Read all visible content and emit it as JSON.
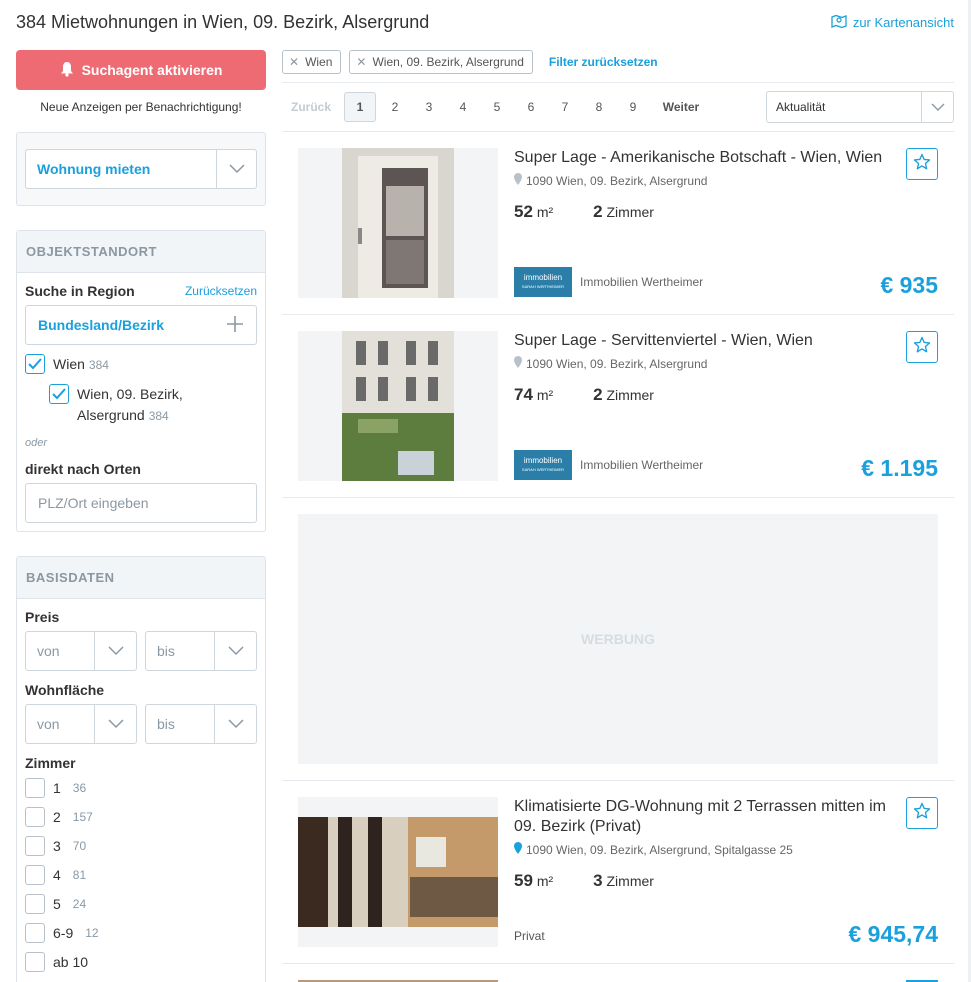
{
  "header": {
    "title": "384 Mietwohnungen in Wien, 09. Bezirk, Alsergrund",
    "map_link": "zur Kartenansicht"
  },
  "sidebar": {
    "search_agent_button": "Suchagent aktivieren",
    "search_agent_sub": "Neue Anzeigen per Benachrichtigung!",
    "property_type": "Wohnung mieten",
    "location": {
      "heading": "OBJEKTSTANDORT",
      "region_label": "Suche in Region",
      "reset": "Zurücksetzen",
      "region_select": "Bundesland/Bezirk",
      "items": [
        {
          "label": "Wien",
          "count": "384",
          "checked": true
        },
        {
          "label": "Wien, 09. Bezirk, Alsergrund",
          "count": "384",
          "checked": true
        }
      ],
      "or": "oder",
      "direct_label": "direkt nach Orten",
      "direct_placeholder": "PLZ/Ort eingeben"
    },
    "basis": {
      "heading": "BASISDATEN",
      "price_label": "Preis",
      "area_label": "Wohnfläche",
      "from": "von",
      "to": "bis",
      "rooms_label": "Zimmer",
      "rooms": [
        {
          "label": "1",
          "count": "36"
        },
        {
          "label": "2",
          "count": "157"
        },
        {
          "label": "3",
          "count": "70"
        },
        {
          "label": "4",
          "count": "81"
        },
        {
          "label": "5",
          "count": "24"
        },
        {
          "label": "6-9",
          "count": "12"
        },
        {
          "label": "ab 10",
          "count": ""
        }
      ]
    }
  },
  "filters": {
    "chips": [
      "Wien",
      "Wien, 09. Bezirk, Alsergrund"
    ],
    "reset": "Filter zurücksetzen"
  },
  "pagination": {
    "prev": "Zurück",
    "pages": [
      "1",
      "2",
      "3",
      "4",
      "5",
      "6",
      "7",
      "8",
      "9"
    ],
    "current": "1",
    "next": "Weiter",
    "sort": "Aktualität"
  },
  "listings": [
    {
      "title": "Super Lage - Amerikanische Botschaft - Wien, Wien",
      "address": "1090 Wien, 09. Bezirk, Alsergrund",
      "area": "52",
      "area_unit": "m²",
      "rooms": "2",
      "rooms_unit": "Zimmer",
      "agent": "Immobilien Wertheimer",
      "agent_logo": "immobilien",
      "agent_logo_sub": "SARAH WERTHEIMER",
      "price": "€ 935"
    },
    {
      "title": "Super Lage - Servittenviertel - Wien, Wien",
      "address": "1090 Wien, 09. Bezirk, Alsergrund",
      "area": "74",
      "area_unit": "m²",
      "rooms": "2",
      "rooms_unit": "Zimmer",
      "agent": "Immobilien Wertheimer",
      "agent_logo": "immobilien",
      "agent_logo_sub": "SARAH WERTHEIMER",
      "price": "€ 1.195"
    },
    {
      "title": "Klimatisierte DG-Wohnung mit 2 Terrassen mitten im 09. Bezirk (Privat)",
      "address": "1090 Wien, 09. Bezirk, Alsergrund, Spitalgasse 25",
      "area": "59",
      "area_unit": "m²",
      "rooms": "3",
      "rooms_unit": "Zimmer",
      "agent": "Privat",
      "price": "€ 945,74"
    }
  ],
  "ad": {
    "label": "WERBUNG"
  },
  "colors": {
    "accent": "#1aa0dc",
    "cta": "#ee6b74"
  }
}
